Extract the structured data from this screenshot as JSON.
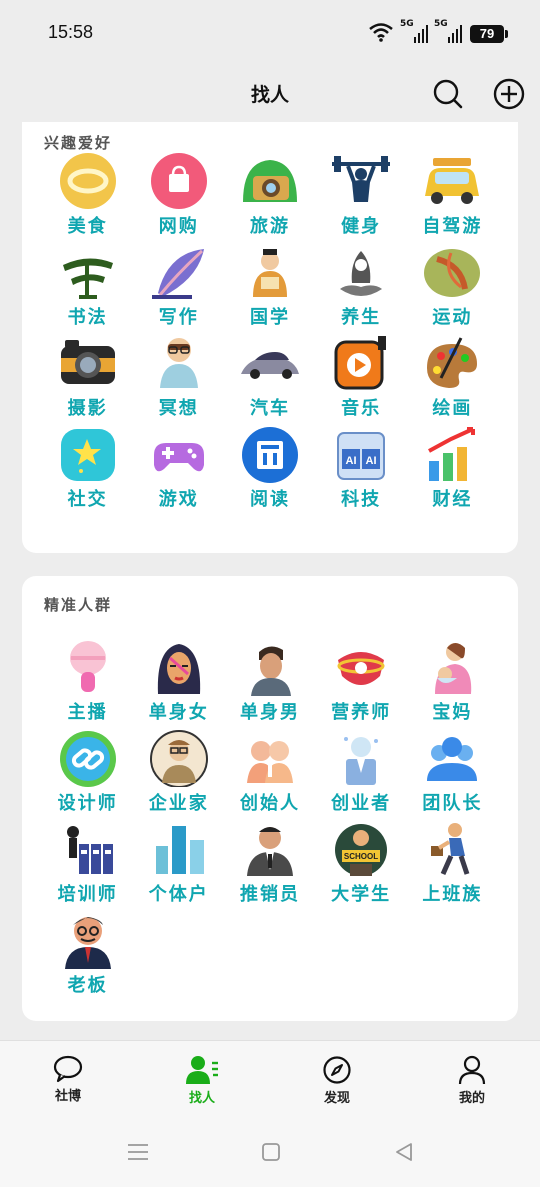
{
  "status_bar": {
    "time": "15:58",
    "signal1_label": "5G",
    "signal2_label": "5G",
    "battery": "79"
  },
  "header": {
    "title": "找人"
  },
  "interests": {
    "title": "兴趣爱好",
    "items": [
      {
        "label": "美食",
        "icon": "gold-ring-icon"
      },
      {
        "label": "网购",
        "icon": "shopping-bag-icon"
      },
      {
        "label": "旅游",
        "icon": "travel-camera-icon"
      },
      {
        "label": "健身",
        "icon": "weightlifter-icon"
      },
      {
        "label": "自驾游",
        "icon": "road-trip-car-icon"
      },
      {
        "label": "书法",
        "icon": "calligraphy-icon"
      },
      {
        "label": "写作",
        "icon": "feather-pen-icon"
      },
      {
        "label": "国学",
        "icon": "scholar-icon"
      },
      {
        "label": "养生",
        "icon": "lotus-bird-icon"
      },
      {
        "label": "运动",
        "icon": "sports-ball-icon"
      },
      {
        "label": "摄影",
        "icon": "camera-icon"
      },
      {
        "label": "冥想",
        "icon": "meditation-icon"
      },
      {
        "label": "汽车",
        "icon": "sports-car-icon"
      },
      {
        "label": "音乐",
        "icon": "music-player-icon"
      },
      {
        "label": "绘画",
        "icon": "paint-palette-icon"
      },
      {
        "label": "社交",
        "icon": "social-star-icon"
      },
      {
        "label": "游戏",
        "icon": "gamepad-icon"
      },
      {
        "label": "阅读",
        "icon": "reading-app-icon"
      },
      {
        "label": "科技",
        "icon": "ai-chip-icon"
      },
      {
        "label": "财经",
        "icon": "bar-growth-icon"
      }
    ]
  },
  "audience": {
    "title": "精准人群",
    "items": [
      {
        "label": "主播",
        "icon": "microphone-icon"
      },
      {
        "label": "单身女",
        "icon": "woman-portrait-icon"
      },
      {
        "label": "单身男",
        "icon": "man-portrait-icon"
      },
      {
        "label": "营养师",
        "icon": "nutrition-icon"
      },
      {
        "label": "宝妈",
        "icon": "mother-baby-icon"
      },
      {
        "label": "设计师",
        "icon": "link-icon"
      },
      {
        "label": "企业家",
        "icon": "businessman-icon"
      },
      {
        "label": "创始人",
        "icon": "founder-icon"
      },
      {
        "label": "创业者",
        "icon": "entrepreneur-icon"
      },
      {
        "label": "团队长",
        "icon": "team-leader-icon"
      },
      {
        "label": "培训师",
        "icon": "trainer-icon"
      },
      {
        "label": "个体户",
        "icon": "self-employed-icon"
      },
      {
        "label": "推销员",
        "icon": "salesman-icon"
      },
      {
        "label": "大学生",
        "icon": "student-icon"
      },
      {
        "label": "上班族",
        "icon": "office-worker-icon"
      },
      {
        "label": "老板",
        "icon": "boss-icon"
      }
    ]
  },
  "bottom_nav": {
    "tabs": [
      {
        "label": "社博",
        "icon": "chat-bubble-icon"
      },
      {
        "label": "找人",
        "icon": "find-people-icon",
        "active": true
      },
      {
        "label": "发现",
        "icon": "compass-icon"
      },
      {
        "label": "我的",
        "icon": "person-icon"
      }
    ]
  },
  "colors": {
    "accent_label": "#10a6b0",
    "active_tab": "#1aad19",
    "background": "#ededed"
  }
}
